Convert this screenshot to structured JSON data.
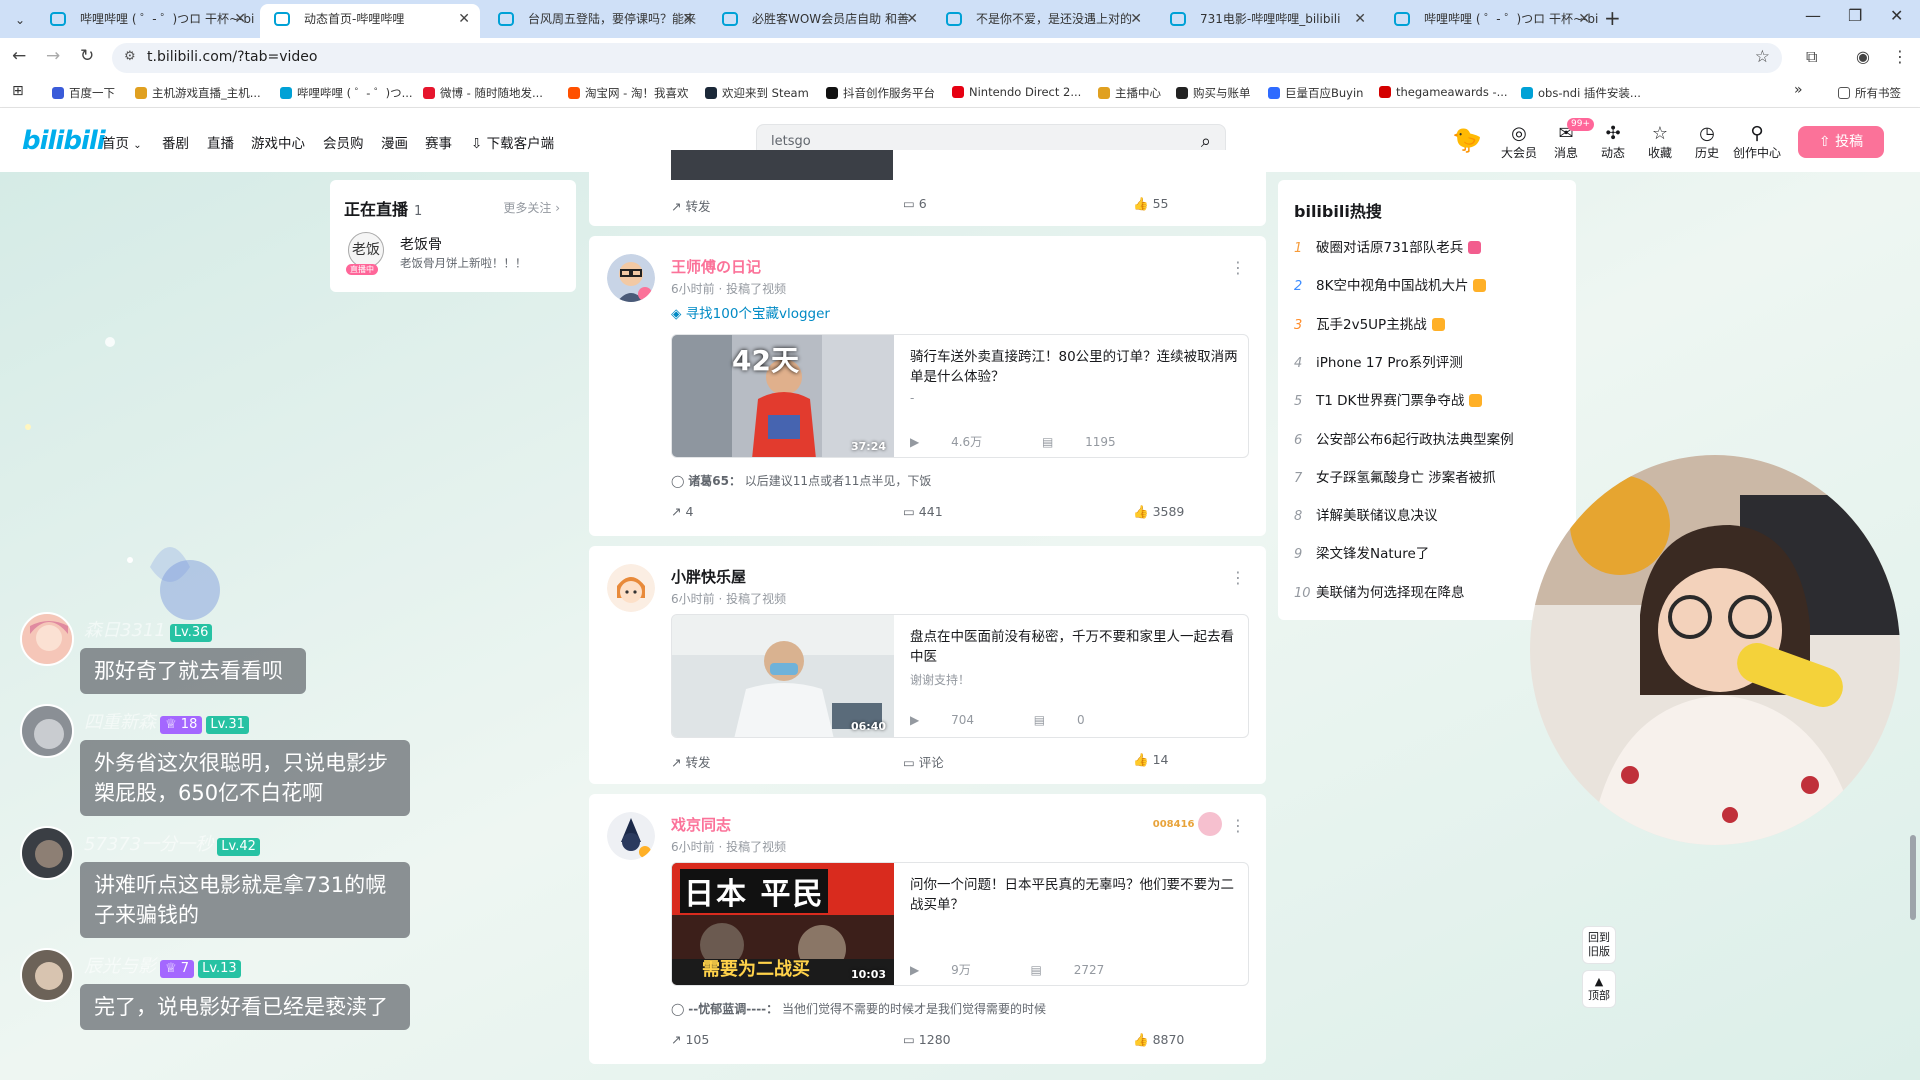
{
  "browser": {
    "tabs": [
      {
        "label": "哔哩哔哩 ( ゜- ゜)つロ 干杯~-bi",
        "active": false
      },
      {
        "label": "动态首页-哔哩哔哩",
        "active": true
      },
      {
        "label": "台风周五登陆，要停课吗？能来",
        "active": false
      },
      {
        "label": "必胜客WOW会员店自助 和善",
        "active": false
      },
      {
        "label": "不是你不爱，是还没遇上对的",
        "active": false
      },
      {
        "label": "731电影-哔哩哔哩_bilibili",
        "active": false
      },
      {
        "label": "哔哩哔哩 ( ゜- ゜)つロ 干杯~-bi",
        "active": false
      }
    ],
    "url": "t.bilibili.com/?tab=video",
    "bookmarks": [
      {
        "label": "百度一下",
        "color": "#3a5bd9"
      },
      {
        "label": "主机游戏直播_主机...",
        "color": "#e0a020"
      },
      {
        "label": "哔哩哔哩 ( ゜- ゜)つ...",
        "color": "#00a1d6"
      },
      {
        "label": "微博 - 随时随地发...",
        "color": "#e6162d"
      },
      {
        "label": "淘宝网 - 淘！我喜欢",
        "color": "#ff5000"
      },
      {
        "label": "欢迎来到 Steam",
        "color": "#1b2838"
      },
      {
        "label": "抖音创作服务平台",
        "color": "#111111"
      },
      {
        "label": "Nintendo Direct 2...",
        "color": "#e60012"
      },
      {
        "label": "主播中心",
        "color": "#e0a020"
      },
      {
        "label": "购买与账单",
        "color": "#222222"
      },
      {
        "label": "巨量百应Buyin",
        "color": "#2f6bff"
      },
      {
        "label": "thegameawards -...",
        "color": "#d40000"
      },
      {
        "label": "obs-ndi 插件安装...",
        "color": "#00a1d6"
      }
    ],
    "all_bookmarks": "所有书签"
  },
  "header": {
    "logo": "bilibili",
    "nav": [
      "首页",
      "番剧",
      "直播",
      "游戏中心",
      "会员购",
      "漫画",
      "赛事",
      "下载客户端"
    ],
    "search_value": "letsgo",
    "icons": [
      {
        "label": "大会员",
        "glyph": "◎"
      },
      {
        "label": "消息",
        "glyph": "✉",
        "badge": "99+"
      },
      {
        "label": "动态",
        "glyph": "✣"
      },
      {
        "label": "收藏",
        "glyph": "☆"
      },
      {
        "label": "历史",
        "glyph": "◷"
      },
      {
        "label": "创作中心",
        "glyph": "⚲"
      }
    ],
    "upload_label": "投稿"
  },
  "live_panel": {
    "title": "正在直播",
    "count": "1",
    "more": "更多关注",
    "streamer_name": "老饭骨",
    "streamer_desc": "老饭骨月饼上新啦！！！",
    "avatar_text": "老饭",
    "live_tag": "直播中"
  },
  "feed": {
    "top_card": {
      "share": "转发",
      "comments": "6",
      "likes": "55"
    },
    "cards": [
      {
        "author": "王师傅の日记",
        "author_color": "#fb7299",
        "meta": "6小时前 · 投稿了视频",
        "topic": "寻找100个宝藏vlogger",
        "video_title": "骑行车送外卖直接跨江！80公里的订单？连续被取消两单是什么体验？",
        "video_desc": "-",
        "duration": "37:24",
        "views": "4.6万",
        "danmaku": "1195",
        "comment_user": "诸葛65：",
        "comment_text": "以后建议11点或者11点半见，下饭",
        "thumb_overlay": "42天",
        "share": "4",
        "comments": "441",
        "likes": "3589"
      },
      {
        "author": "小胖快乐屋",
        "author_color": "#18191c",
        "meta": "6小时前 · 投稿了视频",
        "video_title": "盘点在中医面前没有秘密，千万不要和家里人一起去看中医",
        "video_desc": "谢谢支持！",
        "duration": "06:40",
        "views": "704",
        "danmaku": "0",
        "share": "转发",
        "comments": "评论",
        "likes": "14"
      },
      {
        "author": "戏京同志",
        "author_color": "#fb7299",
        "meta": "6小时前 · 投稿了视频",
        "fan_number": "008416",
        "video_title": "问你一个问题！日本平民真的无辜吗？他们要不要为二战买单？",
        "duration": "10:03",
        "views": "9万",
        "danmaku": "2727",
        "thumb_overlay": "日本 平民",
        "thumb_sub": "需要为二战买",
        "comment_user": "--忧郁蓝调----：",
        "comment_text": "当他们觉得不需要的时候才是我们觉得需要的时候",
        "share": "105",
        "comments": "1280",
        "likes": "8870"
      }
    ]
  },
  "hot_search": {
    "title": "bilibili热搜",
    "items": [
      {
        "rank": "1",
        "text": "破圈对话原731部队老兵",
        "badge": "#f25d8e"
      },
      {
        "rank": "2",
        "text": "8K空中视角中国战机大片",
        "badge": "#ffb027"
      },
      {
        "rank": "3",
        "text": "瓦手2v5UP主挑战",
        "badge": "#ffb027"
      },
      {
        "rank": "4",
        "text": "iPhone 17 Pro系列评测",
        "badge": ""
      },
      {
        "rank": "5",
        "text": "T1 DK世界赛门票争夺战",
        "badge": "#ffb027"
      },
      {
        "rank": "6",
        "text": "公安部公布6起行政执法典型案例",
        "badge": ""
      },
      {
        "rank": "7",
        "text": "女子踩氢氟酸身亡 涉案者被抓",
        "badge": ""
      },
      {
        "rank": "8",
        "text": "详解美联储议息决议",
        "badge": ""
      },
      {
        "rank": "9",
        "text": "梁文锋发Nature了",
        "badge": ""
      },
      {
        "rank": "10",
        "text": "美联储为何选择现在降息",
        "badge": ""
      }
    ]
  },
  "danmu": [
    {
      "name": "森日3311",
      "level": "Lv.36",
      "fan": "",
      "text": "那好奇了就去看看呗"
    },
    {
      "name": "四重新森",
      "level": "Lv.31",
      "fan": "18",
      "text": "外务省这次很聪明，只说电影步槊屁股，650亿不白花啊"
    },
    {
      "name": "57373一分一秒",
      "level": "Lv.42",
      "fan": "",
      "text": "讲难听点这电影就是拿731的幌子来骗钱的"
    },
    {
      "name": "辰光与影",
      "level": "Lv.13",
      "fan": "7",
      "text": "完了，说电影好看已经是亵渎了"
    }
  ],
  "side_buttons": {
    "old_version": "回到旧版",
    "top": "顶部"
  }
}
